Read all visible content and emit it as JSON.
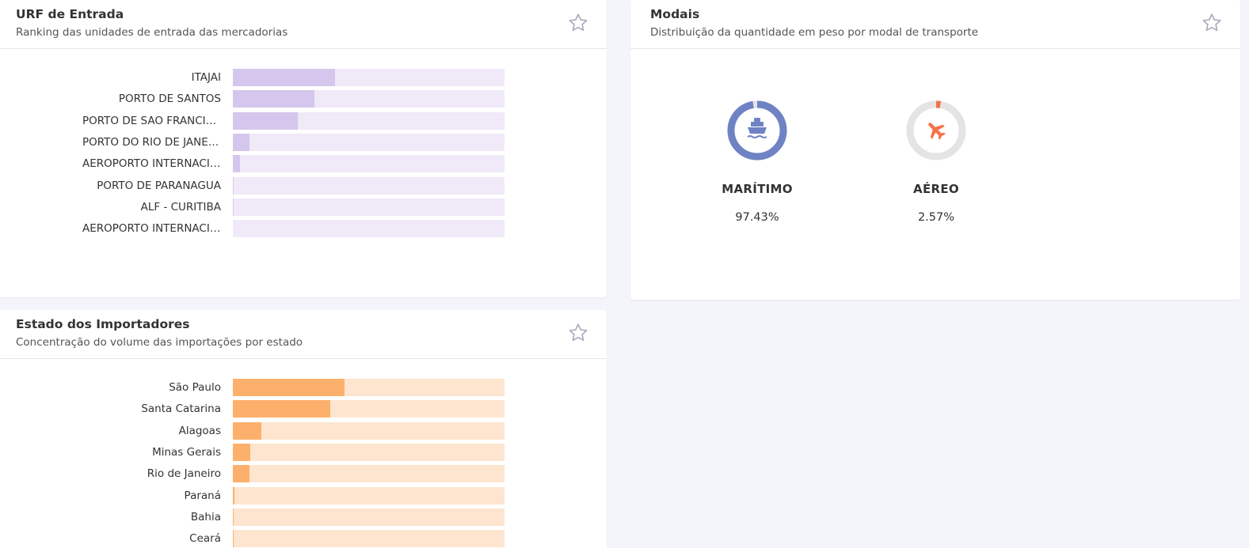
{
  "urf": {
    "title": "URF de Entrada",
    "subtitle": "Ranking das unidades de entrada das mercadorias",
    "items": [
      {
        "label": "ITAJAI",
        "value": 37.5
      },
      {
        "label": "PORTO DE SANTOS",
        "value": 30.0
      },
      {
        "label": "PORTO DE SAO FRANCISCO DO SUL",
        "value": 24.0
      },
      {
        "label": "PORTO DO RIO DE JANEIRO",
        "value": 6.0
      },
      {
        "label": "AEROPORTO INTERNACIONAL",
        "value": 2.5
      },
      {
        "label": "PORTO DE PARANAGUA",
        "value": 0.4
      },
      {
        "label": "ALF - CURITIBA",
        "value": 0.3
      },
      {
        "label": "AEROPORTO INTERNACIONAL",
        "value": 0.0
      }
    ]
  },
  "modais": {
    "title": "Modais",
    "subtitle": "Distribuição da quantidade em peso por modal de transporte",
    "items": [
      {
        "name": "MARÍTIMO",
        "pct_label": "97.43%",
        "pct": 97.43,
        "icon": "ship-icon",
        "color": "#6f83c4"
      },
      {
        "name": "AÉREO",
        "pct_label": "2.57%",
        "pct": 2.57,
        "icon": "airplane-icon",
        "color": "#f4734a"
      }
    ]
  },
  "estado": {
    "title": "Estado dos Importadores",
    "subtitle": "Concentração do volume das importações por estado",
    "items": [
      {
        "label": "São Paulo",
        "value": 41.0
      },
      {
        "label": "Santa Catarina",
        "value": 36.0
      },
      {
        "label": "Alagoas",
        "value": 10.5
      },
      {
        "label": "Minas Gerais",
        "value": 6.5
      },
      {
        "label": "Rio de Janeiro",
        "value": 6.0
      },
      {
        "label": "Paraná",
        "value": 0.5
      },
      {
        "label": "Bahia",
        "value": 0.4
      },
      {
        "label": "Ceará",
        "value": 0.3
      }
    ]
  },
  "colors": {
    "purple_track": "#efe9f8",
    "purple_fill": "#d4c6ec",
    "orange_track": "#fde5cf",
    "orange_fill": "#fdb06b",
    "donut_bg": "#e4e4e4"
  }
}
